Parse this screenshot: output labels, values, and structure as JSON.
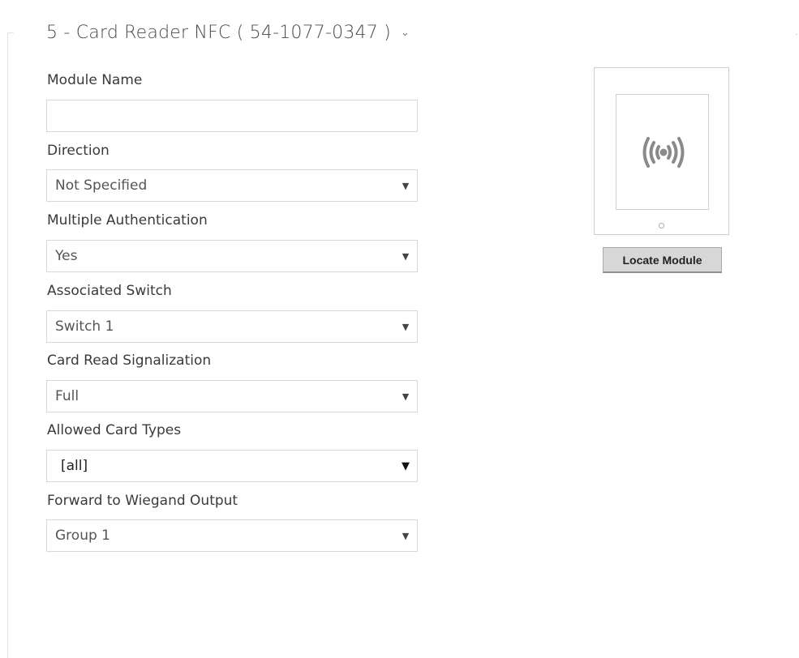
{
  "header": {
    "title": "5 - Card Reader NFC ( 54-1077-0347 )"
  },
  "fields": {
    "module_name": {
      "label": "Module Name",
      "value": ""
    },
    "direction": {
      "label": "Direction",
      "value": "Not Specified"
    },
    "multiple_auth": {
      "label": "Multiple Authentication",
      "value": "Yes"
    },
    "associated_switch": {
      "label": "Associated Switch",
      "value": "Switch 1"
    },
    "card_read_signalization": {
      "label": "Card Read Signalization",
      "value": "Full"
    },
    "allowed_card_types": {
      "label": "Allowed Card Types",
      "value": "[all]"
    },
    "forward_wiegand": {
      "label": "Forward to Wiegand Output",
      "value": "Group 1"
    }
  },
  "device": {
    "icon": "nfc-waves-icon",
    "locate_button_label": "Locate Module"
  },
  "colors": {
    "border": "#d8d8d8",
    "button_bg": "#d7d7d7",
    "icon": "#8a8a8a"
  }
}
